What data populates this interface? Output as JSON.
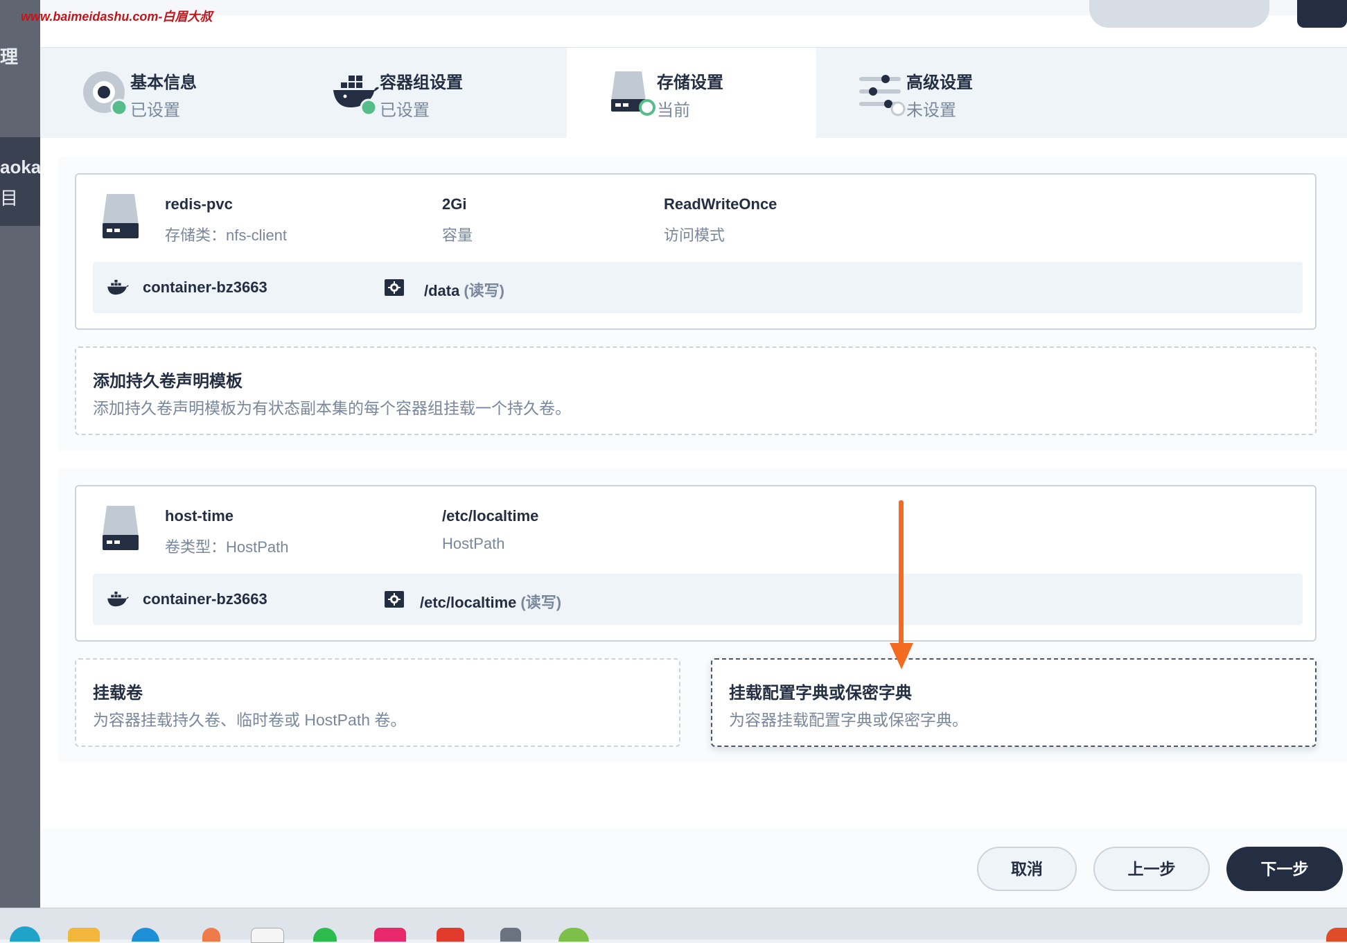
{
  "watermark": "www.baimeidashu.com-白眉大叔",
  "left_partial": {
    "char1": "理",
    "label": "aoka",
    "char2": "目"
  },
  "steps": [
    {
      "title": "基本信息",
      "status": "已设置"
    },
    {
      "title": "容器组设置",
      "status": "已设置"
    },
    {
      "title": "存储设置",
      "status": "当前"
    },
    {
      "title": "高级设置",
      "status": "未设置"
    }
  ],
  "pvc_section": {
    "volume": {
      "name": "redis-pvc",
      "storage_class": "存储类：nfs-client",
      "capacity": "2Gi",
      "capacity_label": "容量",
      "access_mode": "ReadWriteOnce",
      "access_mode_label": "访问模式",
      "mount": {
        "container": "container-bz3663",
        "path": "/data",
        "mode": "(读写)"
      }
    },
    "add_template": {
      "title": "添加持久卷声明模板",
      "desc": "添加持久卷声明模板为有状态副本集的每个容器组挂载一个持久卷。"
    }
  },
  "volume_section": {
    "volume": {
      "name": "host-time",
      "type": "卷类型：HostPath",
      "path": "/etc/localtime",
      "path_label": "HostPath",
      "mount": {
        "container": "container-bz3663",
        "path": "/etc/localtime",
        "mode": "(读写)"
      }
    },
    "mount_volume": {
      "title": "挂载卷",
      "desc": "为容器挂载持久卷、临时卷或 HostPath 卷。"
    },
    "mount_config": {
      "title": "挂载配置字典或保密字典",
      "desc": "为容器挂载配置字典或保密字典。"
    }
  },
  "footer": {
    "cancel": "取消",
    "prev": "上一步",
    "next": "下一步"
  },
  "colors": {
    "primary": "#242e42",
    "success": "#55bc8a",
    "annotation": "#f26b21",
    "muted": "#79879c"
  }
}
